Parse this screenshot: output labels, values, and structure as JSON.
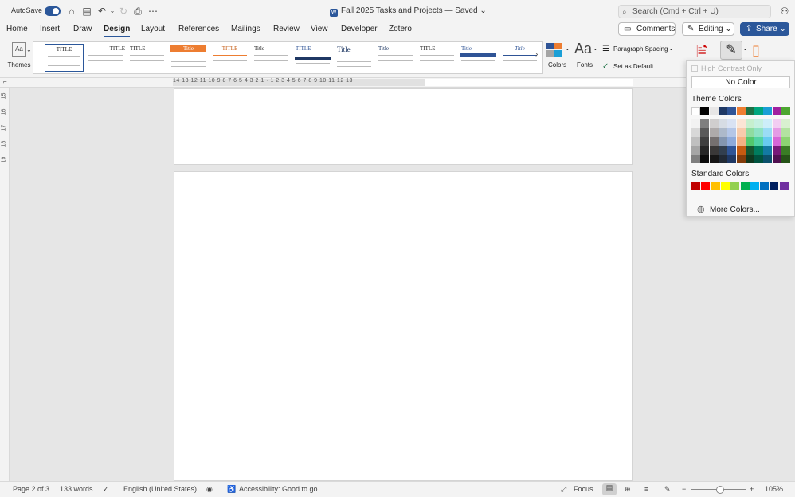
{
  "titlebar": {
    "autosave_label": "AutoSave",
    "doc_title": "Fall 2025 Tasks and Projects — Saved",
    "search_placeholder": "Search (Cmd + Ctrl + U)"
  },
  "tabs": [
    "Home",
    "Insert",
    "Draw",
    "Design",
    "Layout",
    "References",
    "Mailings",
    "Review",
    "View",
    "Developer",
    "Zotero"
  ],
  "active_tab": "Design",
  "header_buttons": {
    "comments": "Comments",
    "editing": "Editing",
    "share": "Share"
  },
  "ribbon": {
    "themes_label": "Themes",
    "style_titles": [
      "TITLE",
      "TITLE",
      "TITLE",
      "Title",
      "TITLE",
      "Title",
      "TITLE",
      "Title",
      "Title",
      "TITLE",
      "Title",
      "Title"
    ],
    "colors_label": "Colors",
    "fonts_label": "Fonts",
    "paragraph_spacing_label": "Paragraph Spacing",
    "set_default_label": "Set as Default"
  },
  "ruler": {
    "numbers": "14 13 12 11 10 9 8 7 6 5 4 3 2 1 · 1 2 3 4 5 6 7 8 9 10 11 12 13"
  },
  "vruler": {
    "numbers": [
      "15",
      "16",
      "17",
      "18",
      "19"
    ]
  },
  "status": {
    "page": "Page 2 of 3",
    "words": "133 words",
    "language": "English (United States)",
    "accessibility": "Accessibility: Good to go",
    "focus": "Focus",
    "zoom": "105%"
  },
  "page_color_panel": {
    "high_contrast": "High Contrast Only",
    "no_color": "No Color",
    "theme_colors_label": "Theme Colors",
    "theme_top_row": [
      "#ffffff",
      "#000000",
      "#e7e6e6",
      "#1f3864",
      "#2f5496",
      "#ed7d31",
      "#1e7145",
      "#00a67e",
      "#1a9fd6",
      "#a020a0",
      "#4da631"
    ],
    "theme_shades": [
      [
        "#f2f2f2",
        "#7f7f7f",
        "#d0cece",
        "#d6dce4",
        "#d9e2f3",
        "#fbe5d5",
        "#c6efce",
        "#c6f0e1",
        "#cdeefa",
        "#f2cdf2",
        "#d9f0d0"
      ],
      [
        "#d8d8d8",
        "#595959",
        "#aeaaaa",
        "#adb9ca",
        "#b4c6e7",
        "#f7cbac",
        "#8fdca0",
        "#8fe2c4",
        "#9bdcf5",
        "#e59be5",
        "#b3e2a1"
      ],
      [
        "#bfbfbf",
        "#3f3f3f",
        "#757070",
        "#8496b0",
        "#8eaadb",
        "#f4b183",
        "#52c76d",
        "#52d3a5",
        "#67cbf0",
        "#d766d7",
        "#8cd372"
      ],
      [
        "#a5a5a5",
        "#262626",
        "#3a3838",
        "#323f4f",
        "#2f5496",
        "#c55a11",
        "#16552f",
        "#007c5e",
        "#137aa3",
        "#781878",
        "#3a7c25"
      ],
      [
        "#7f7f7f",
        "#0c0c0c",
        "#171616",
        "#222a35",
        "#1f3864",
        "#833c0b",
        "#0f381f",
        "#00533f",
        "#0c516c",
        "#501050",
        "#265318"
      ]
    ],
    "standard_colors_label": "Standard Colors",
    "standard_colors": [
      "#c00000",
      "#ff0000",
      "#ffc000",
      "#ffff00",
      "#92d050",
      "#00b050",
      "#00b0f0",
      "#0070c0",
      "#002060",
      "#7030a0"
    ],
    "more_colors": "More Colors..."
  },
  "colors": {
    "accent": "#2b579a"
  }
}
